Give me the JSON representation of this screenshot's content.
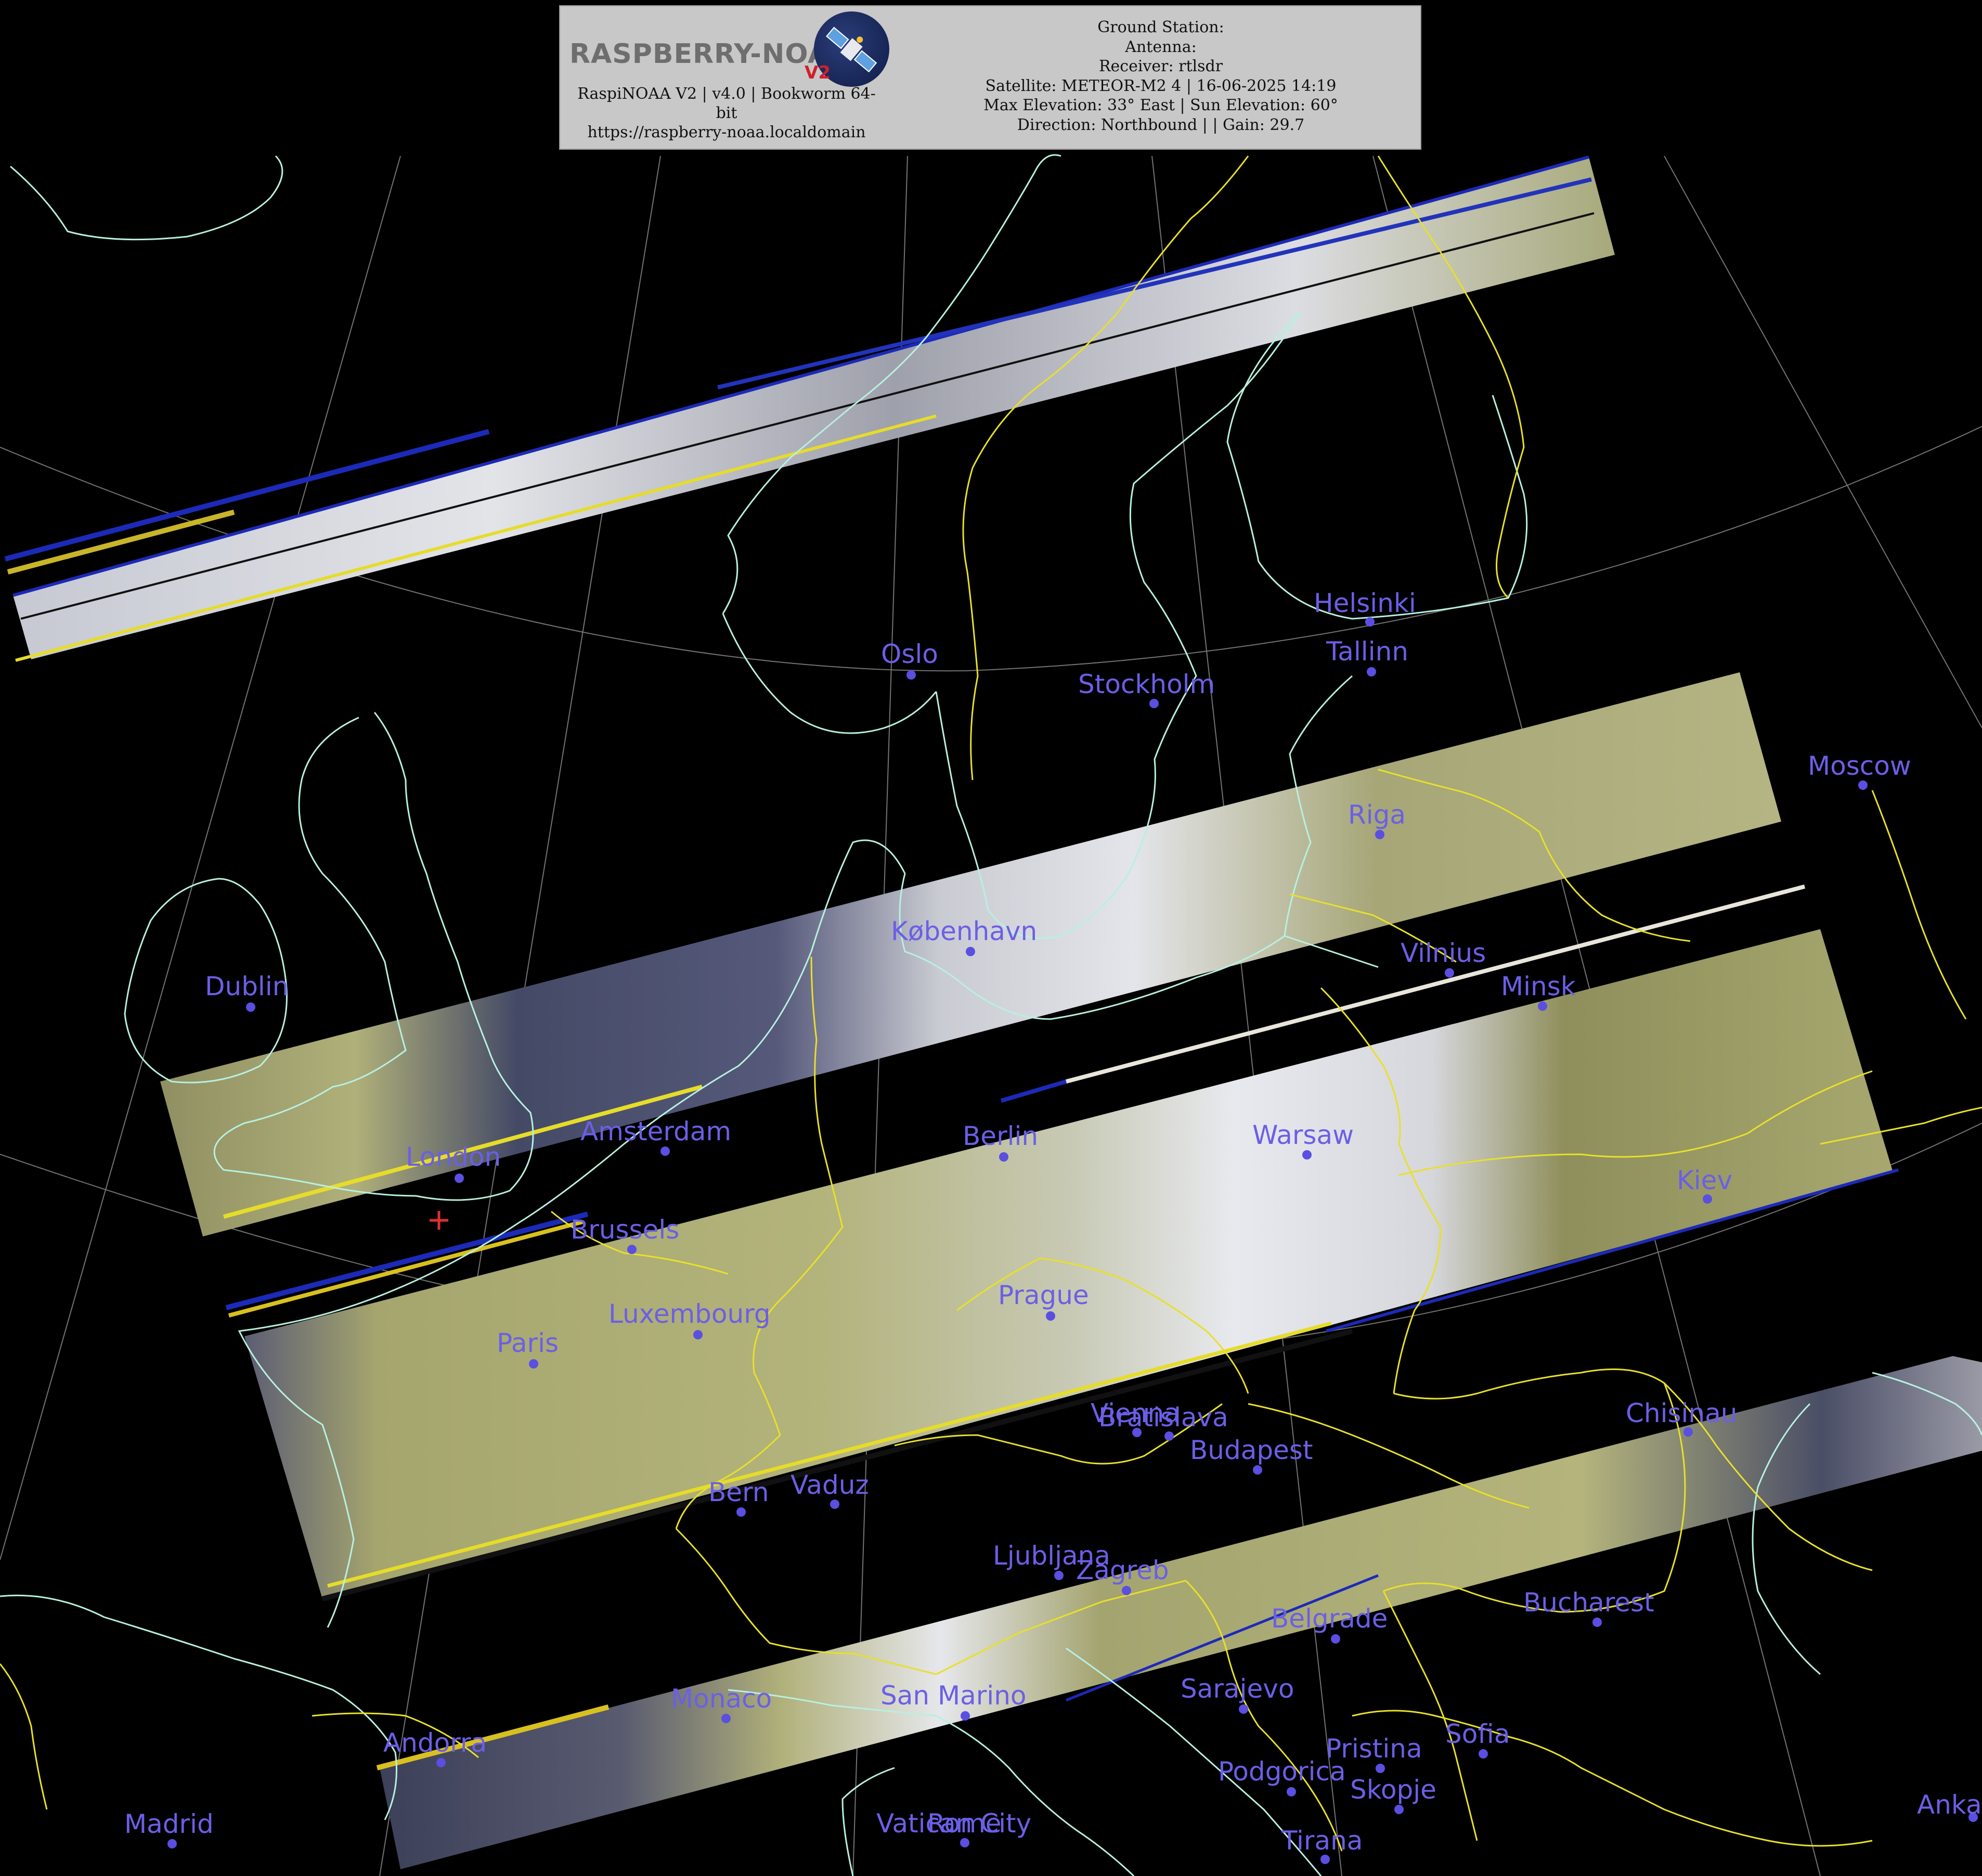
{
  "header": {
    "logo_text": "RASPBERRY-NOAA",
    "logo_badge": "V2",
    "software_line1": "RaspiNOAA V2 | v4.0 | Bookworm 64-",
    "software_line2": "bit",
    "url": "https://raspberry-noaa.localdomain",
    "ground_station": "Ground Station:",
    "antenna": "Antenna:",
    "receiver": "Receiver: rtlsdr",
    "satellite": "Satellite: METEOR-M2 4 | 16-06-2025 14:19",
    "elevation": "Max Elevation: 33° East | Sun Elevation: 60°",
    "direction": "Direction: Northbound | | Gain: 29.7"
  },
  "colors": {
    "coastline": "#b8f0e0",
    "border": "#e8e02a",
    "city": "#6b5fe6",
    "graticule": "#9a9a9a",
    "imagery_land": "#a0a060",
    "imagery_cloud": "#d8dae0",
    "imagery_sea": "#3a3f58"
  },
  "cities": [
    {
      "name": "Oslo"
    },
    {
      "name": "Stockholm"
    },
    {
      "name": "Helsinki"
    },
    {
      "name": "Tallinn"
    },
    {
      "name": "Moscow"
    },
    {
      "name": "Riga"
    },
    {
      "name": "København"
    },
    {
      "name": "Vilnius"
    },
    {
      "name": "Minsk"
    },
    {
      "name": "Dublin"
    },
    {
      "name": "Amsterdam"
    },
    {
      "name": "London"
    },
    {
      "name": "Berlin"
    },
    {
      "name": "Warsaw"
    },
    {
      "name": "Kiev"
    },
    {
      "name": "Brussels"
    },
    {
      "name": "Luxembourg"
    },
    {
      "name": "Prague"
    },
    {
      "name": "Paris"
    },
    {
      "name": "Vienna"
    },
    {
      "name": "Bratislava"
    },
    {
      "name": "Budapest"
    },
    {
      "name": "Chisinau"
    },
    {
      "name": "Bern"
    },
    {
      "name": "Vaduz"
    },
    {
      "name": "Ljubljana"
    },
    {
      "name": "Zagreb"
    },
    {
      "name": "Belgrade"
    },
    {
      "name": "Bucharest"
    },
    {
      "name": "Monaco"
    },
    {
      "name": "San Marino"
    },
    {
      "name": "Sarajevo"
    },
    {
      "name": "Andorra"
    },
    {
      "name": "Pristina"
    },
    {
      "name": "Sofia"
    },
    {
      "name": "Podgorica"
    },
    {
      "name": "Skopje"
    },
    {
      "name": "Madrid"
    },
    {
      "name": "Vatican City"
    },
    {
      "name": "Rome"
    },
    {
      "name": "Tirana"
    },
    {
      "name": "Ankara"
    }
  ]
}
